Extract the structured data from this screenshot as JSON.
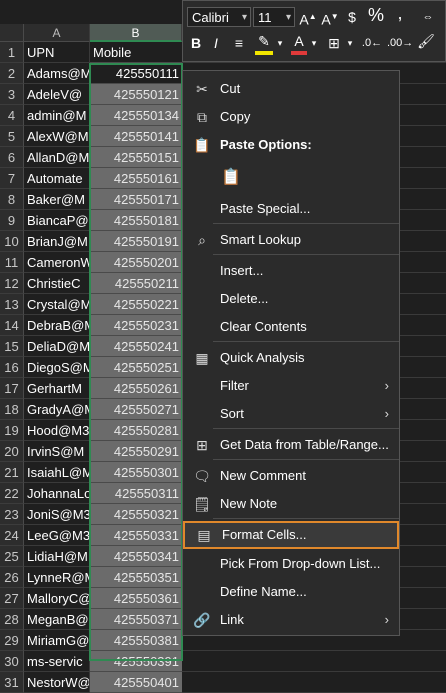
{
  "mini_toolbar": {
    "font_name": "Calibri",
    "font_size": "11",
    "grow_font": "A^",
    "shrink_font": "Av",
    "currency": "$",
    "percent": "%",
    "comma": ",",
    "bold": "B",
    "italic": "I",
    "font_color_letter": "A",
    "highlight_color": "#f2e600",
    "font_color": "#e03a3a"
  },
  "sheet": {
    "columns": [
      "A",
      "B"
    ],
    "header_row": {
      "num": "1",
      "a": "UPN",
      "b": "Mobile"
    },
    "rows": [
      {
        "num": "2",
        "a": "Adams@M",
        "b": "425550111"
      },
      {
        "num": "3",
        "a": "AdeleV@",
        "b": "425550121"
      },
      {
        "num": "4",
        "a": "admin@M",
        "b": "425550134"
      },
      {
        "num": "5",
        "a": "AlexW@M",
        "b": "425550141"
      },
      {
        "num": "6",
        "a": "AllanD@M",
        "b": "425550151"
      },
      {
        "num": "7",
        "a": "Automate",
        "b": "425550161"
      },
      {
        "num": "8",
        "a": "Baker@M",
        "b": "425550171"
      },
      {
        "num": "9",
        "a": "BiancaP@",
        "b": "425550181"
      },
      {
        "num": "10",
        "a": "BrianJ@M",
        "b": "425550191"
      },
      {
        "num": "11",
        "a": "CameronW",
        "b": "425550201"
      },
      {
        "num": "12",
        "a": "ChristieC",
        "b": "425550211"
      },
      {
        "num": "13",
        "a": "Crystal@M",
        "b": "425550221"
      },
      {
        "num": "14",
        "a": "DebraB@M",
        "b": "425550231"
      },
      {
        "num": "15",
        "a": "DeliaD@M",
        "b": "425550241"
      },
      {
        "num": "16",
        "a": "DiegoS@M",
        "b": "425550251"
      },
      {
        "num": "17",
        "a": "GerhartM",
        "b": "425550261"
      },
      {
        "num": "18",
        "a": "GradyA@M",
        "b": "425550271"
      },
      {
        "num": "19",
        "a": "Hood@M3",
        "b": "425550281"
      },
      {
        "num": "20",
        "a": "IrvinS@M",
        "b": "425550291"
      },
      {
        "num": "21",
        "a": "IsaiahL@M",
        "b": "425550301"
      },
      {
        "num": "22",
        "a": "JohannaLo",
        "b": "425550311"
      },
      {
        "num": "23",
        "a": "JoniS@M3",
        "b": "425550321"
      },
      {
        "num": "24",
        "a": "LeeG@M3",
        "b": "425550331"
      },
      {
        "num": "25",
        "a": "LidiaH@M",
        "b": "425550341"
      },
      {
        "num": "26",
        "a": "LynneR@M",
        "b": "425550351"
      },
      {
        "num": "27",
        "a": "MalloryC@",
        "b": "425550361"
      },
      {
        "num": "28",
        "a": "MeganB@",
        "b": "425550371"
      },
      {
        "num": "29",
        "a": "MiriamG@",
        "b": "425550381"
      },
      {
        "num": "30",
        "a": "ms-servic",
        "b": "425550391"
      },
      {
        "num": "31",
        "a": "NestorW@",
        "b": "425550401"
      }
    ]
  },
  "context_menu": {
    "cut": "Cut",
    "copy": "Copy",
    "paste_options": "Paste Options:",
    "paste_special": "Paste Special...",
    "smart_lookup": "Smart Lookup",
    "insert": "Insert...",
    "delete": "Delete...",
    "clear_contents": "Clear Contents",
    "quick_analysis": "Quick Analysis",
    "filter": "Filter",
    "sort": "Sort",
    "get_data": "Get Data from Table/Range...",
    "new_comment": "New Comment",
    "new_note": "New Note",
    "format_cells": "Format Cells...",
    "pick_dropdown": "Pick From Drop-down List...",
    "define_name": "Define Name...",
    "link": "Link"
  }
}
